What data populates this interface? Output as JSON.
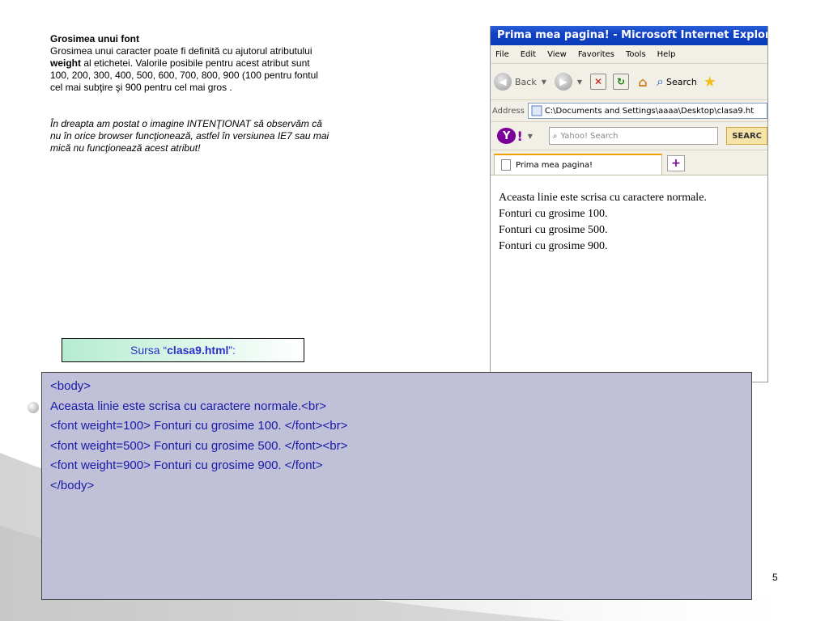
{
  "slide": {
    "heading": "Grosimea unui font",
    "paragraph": [
      "Grosimea unui caracter poate fi definită cu ajutorul atributului",
      "weight",
      " al etichetei. Valorile posibile pentru acest atribut sunt",
      "100, 200, 300, 400, 500, 600, 700, 800, 900 (100 pentru fontul",
      "cel mai subţire şi 900 pentru cel mai gros ."
    ],
    "note_lines": [
      "În dreapta am postat o imagine INTENŢIONAT să observăm că",
      "nu în orice browser funcţionează, astfel în versiunea IE7 sau mai",
      "mică nu funcţionează acest atribut!"
    ],
    "source_prefix": "Sursa “",
    "source_file": "clasa9.html",
    "source_suffix": "”:",
    "page_number": "5"
  },
  "browser": {
    "title": "Prima mea pagina! - Microsoft Internet Explorer",
    "menu": [
      "File",
      "Edit",
      "View",
      "Favorites",
      "Tools",
      "Help"
    ],
    "toolbar": {
      "back_label": "Back",
      "search_label": "Search"
    },
    "address_label": "Address",
    "address_value": "C:\\Documents and Settings\\aaaa\\Desktop\\clasa9.ht",
    "yahoo": {
      "logo": "Y",
      "search_placeholder": "Yahoo! Search",
      "search_button": "SEARC"
    },
    "tab_title": "Prima mea pagina!",
    "new_tab_symbol": "+",
    "content_lines": [
      "Aceasta linie este scrisa cu caractere normale.",
      "Fonturi cu grosime 100.",
      "Fonturi cu grosime 500.",
      "Fonturi cu grosime 900."
    ]
  },
  "code_lines": [
    "<body>",
    "Aceasta linie este scrisa cu caractere normale.<br>",
    "<font weight=100> Fonturi cu grosime 100. </font><br>",
    "<font weight=500> Fonturi cu grosime 500. </font><br>",
    "<font weight=900> Fonturi cu grosime 900. </font>",
    "</body>"
  ],
  "colors": {
    "code_text": "#1a1aa8",
    "code_background": "#c0c0d8",
    "source_text": "#2a30c8",
    "ie_titlebar": "#0a3cb8"
  },
  "icons": {
    "title_icon": "ie-logo-icon",
    "back": "back-arrow-icon",
    "forward": "forward-arrow-icon",
    "stop": "stop-icon",
    "refresh": "refresh-icon",
    "home": "home-icon",
    "search": "magnifier-icon",
    "favorites": "star-icon"
  }
}
